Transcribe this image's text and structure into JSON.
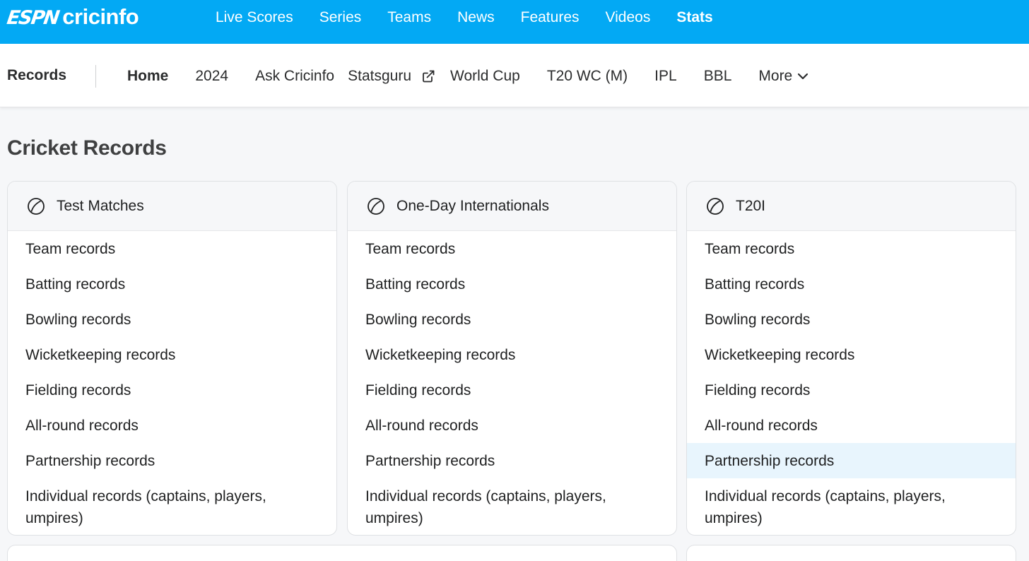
{
  "header": {
    "logo_espn": "ESPN",
    "logo_cricinfo": "cricinfo",
    "nav": [
      "Live Scores",
      "Series",
      "Teams",
      "News",
      "Features",
      "Videos",
      "Stats"
    ],
    "active_nav": "Stats",
    "brand_color": "#03a9f4"
  },
  "subnav": {
    "section_title": "Records",
    "items": [
      "Home",
      "2024",
      "Ask Cricinfo",
      "Statsguru",
      "World Cup",
      "T20 WC (M)",
      "IPL",
      "BBL",
      "More"
    ],
    "active": "Home",
    "statsguru_icon": "external-link-icon",
    "more_icon": "chevron-down-icon"
  },
  "page": {
    "title": "Cricket Records"
  },
  "cards": [
    {
      "title": "Test Matches",
      "icon": "cricket-ball-icon",
      "items": [
        "Team records",
        "Batting records",
        "Bowling records",
        "Wicketkeeping records",
        "Fielding records",
        "All-round records",
        "Partnership records",
        "Individual records (captains, players, umpires)"
      ]
    },
    {
      "title": "One-Day Internationals",
      "icon": "cricket-ball-icon",
      "items": [
        "Team records",
        "Batting records",
        "Bowling records",
        "Wicketkeeping records",
        "Fielding records",
        "All-round records",
        "Partnership records",
        "Individual records (captains, players, umpires)"
      ]
    },
    {
      "title": "T20I",
      "icon": "cricket-ball-icon",
      "items": [
        "Team records",
        "Batting records",
        "Bowling records",
        "Wicketkeeping records",
        "Fielding records",
        "All-round records",
        "Partnership records",
        "Individual records (captains, players, umpires)"
      ],
      "hovered_item": "Partnership records"
    }
  ]
}
